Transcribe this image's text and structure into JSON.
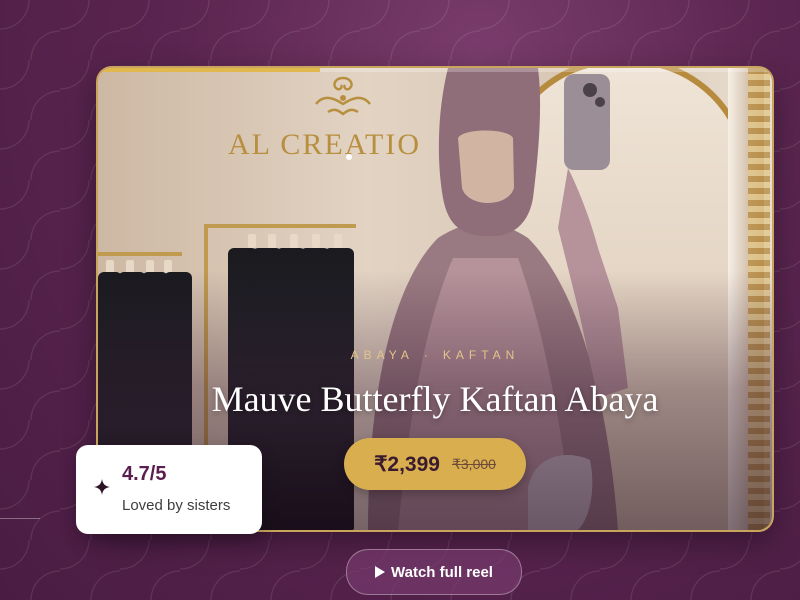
{
  "product": {
    "category_left": "ABAYA",
    "category_separator": "·",
    "category_right": "KAFTAN",
    "title": "Mauve Butterfly Kaftan Abaya",
    "price": "₹2,399",
    "original_price": "₹3,000"
  },
  "backdrop": {
    "store_sign_text": "AL CREATIO"
  },
  "reel": {
    "progress_percent": 33
  },
  "rating": {
    "value": "4.7/5",
    "label": "Loved by sisters"
  },
  "actions": {
    "watch_reel_label": "Watch full reel"
  },
  "colors": {
    "accent_gold": "#d8ae4f",
    "title_text": "#ffffff",
    "rating_text": "#5a1f4e",
    "background_plum": "#5a2550"
  },
  "icons": {
    "play": "play-icon",
    "sparkle": "sparkle-icon"
  }
}
